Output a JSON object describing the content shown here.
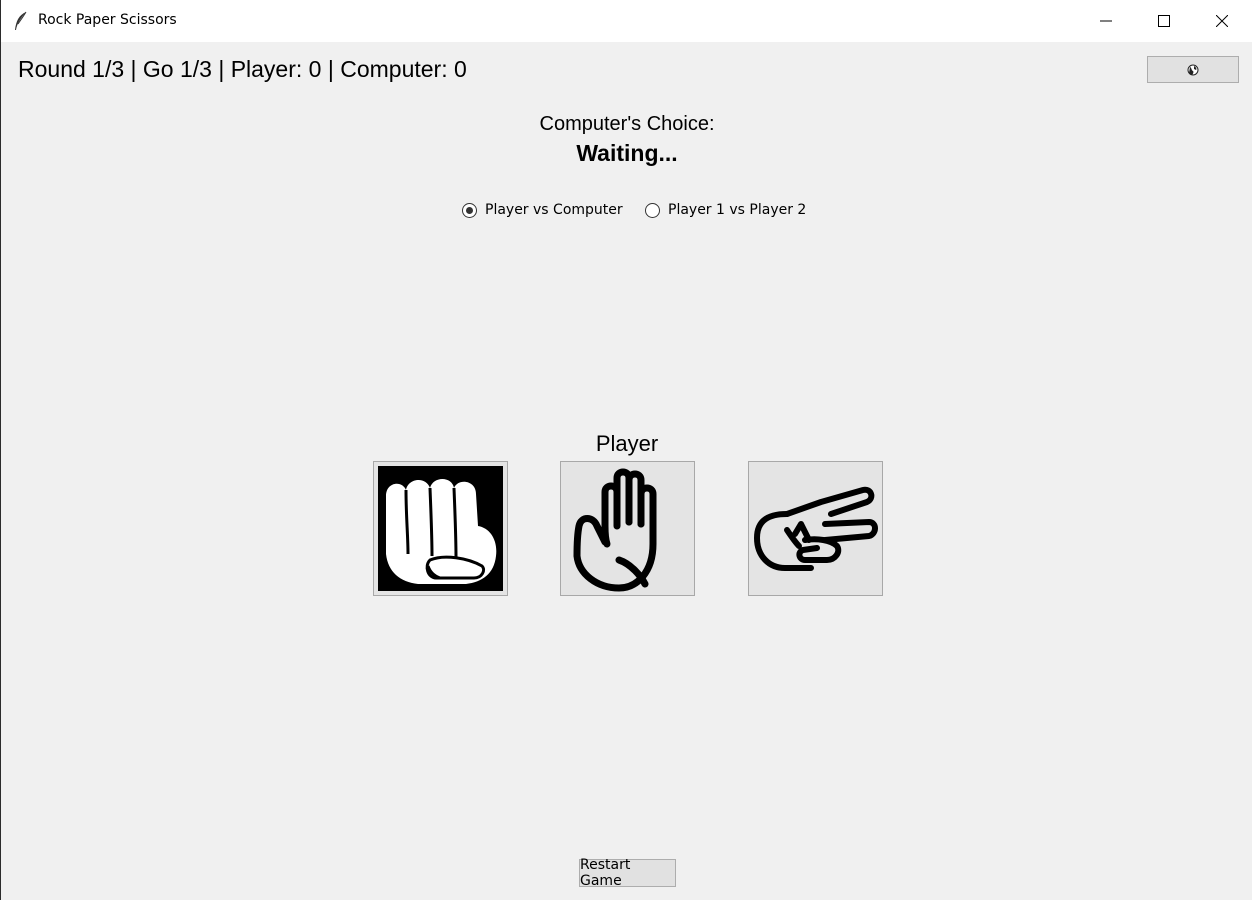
{
  "window": {
    "title": "Rock Paper Scissors",
    "icon": "feather-icon"
  },
  "score": {
    "text": "Round 1/3 | Go 1/3 | Player: 0 | Computer: 0"
  },
  "corner_button": {
    "icon": "globe-icon"
  },
  "computer": {
    "label": "Computer's Choice:",
    "value": "Waiting..."
  },
  "mode": {
    "options": [
      {
        "label": "Player vs Computer",
        "selected": true
      },
      {
        "label": "Player 1 vs Player 2",
        "selected": false
      }
    ]
  },
  "player": {
    "label": "Player"
  },
  "choices": [
    {
      "name": "rock",
      "icon": "fist-icon"
    },
    {
      "name": "paper",
      "icon": "open-hand-icon"
    },
    {
      "name": "scissors",
      "icon": "scissors-hand-icon"
    }
  ],
  "restart": {
    "label": "Restart Game"
  }
}
